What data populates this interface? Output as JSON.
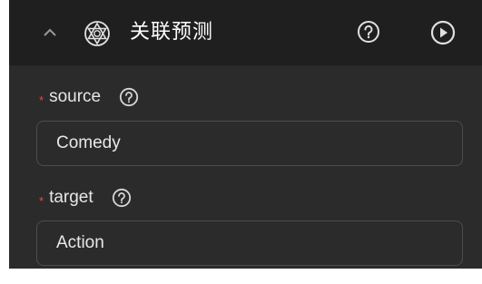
{
  "header": {
    "title": "关联预测",
    "collapse_icon": "chevron-up-icon",
    "node_icon": "star-of-david-icon",
    "help_icon": "question-circle-icon",
    "run_icon": "play-circle-icon"
  },
  "fields": [
    {
      "label": "source",
      "required": true,
      "value": "Comedy"
    },
    {
      "label": "target",
      "required": true,
      "value": "Action"
    }
  ],
  "colors": {
    "header_bg": "#1f1f1f",
    "panel_bg": "#2b2b2b",
    "required": "#e5484d",
    "input_border": "#4d4d4d"
  }
}
